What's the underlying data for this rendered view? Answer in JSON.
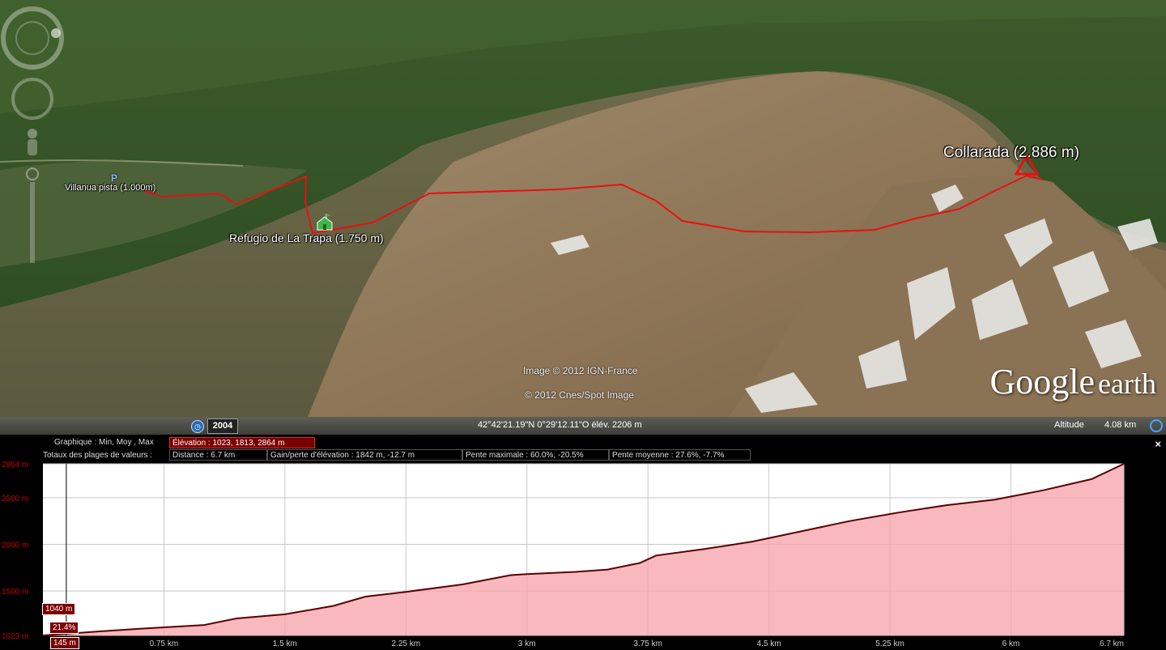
{
  "map": {
    "route_color": "#e81010",
    "labels": {
      "start": "Villanua pista (1.000m)",
      "refuge": "Refugio de La Trapa (1.750 m)",
      "summit": "Collarada (2.886 m)"
    },
    "icons": {
      "start": "parking-icon",
      "refuge": "hut-flag-icon",
      "summit": "summit-triangle-icon"
    },
    "credits": [
      "Image © 2012 IGN-France",
      "© 2012 Cnes/Spot Image"
    ],
    "logo": {
      "google": "Google",
      "earth": "earth"
    }
  },
  "statusbar": {
    "year": "2004",
    "coords": "42°42'21.19\"N   0°29'12.11\"O  élév. 2206 m",
    "altitude_label": "Altitude",
    "altitude_value": "4.08 km"
  },
  "profile": {
    "graph_label": "Graphique : Min, Moy , Max",
    "elevation": "Élévation : 1023, 1813, 2864 m",
    "totals_label": "Totaux des plages de valeurs :",
    "distance": "Distance : 6.7 km",
    "gain_loss": "Gain/perte d'élévation : 1842 m, -12.7 m",
    "max_slope": "Pente maximale : 60.0%, -20.5%",
    "avg_slope": "Pente moyenne : 27.6%, -7.7%",
    "close": "×",
    "cursor": {
      "elevation": "1040 m",
      "slope": "21.4%",
      "distance": "145 m",
      "distance_km": 0.145
    }
  },
  "chart_data": {
    "type": "area",
    "xlabel": "",
    "ylabel": "",
    "xlim": [
      0,
      6.7
    ],
    "ylim": [
      1023,
      2864
    ],
    "y_ticks": [
      1023,
      1500,
      2000,
      2500,
      2864
    ],
    "y_tick_labels": [
      "1023 m",
      "1500 m",
      "2000 m",
      "2500 m",
      "2864 m"
    ],
    "x_ticks": [
      0.75,
      1.5,
      2.25,
      3,
      3.75,
      4.5,
      5.25,
      6,
      6.7
    ],
    "x_tick_labels": [
      "0.75 km",
      "1.5 km",
      "2.25 km",
      "3 km",
      "3.75 km",
      "4.5 km",
      "5.25 km",
      "6 km",
      "6.7 km"
    ],
    "line_color": "#5a0000",
    "fill_color": "#f5a0a8",
    "series": [
      {
        "x": [
          0,
          0.3,
          0.6,
          1.0,
          1.2,
          1.5,
          1.8,
          2.0,
          2.25,
          2.6,
          2.9,
          3.0,
          3.3,
          3.5,
          3.7,
          3.8,
          4.1,
          4.4,
          4.7,
          5.0,
          5.3,
          5.6,
          5.9,
          6.2,
          6.5,
          6.7
        ],
        "y": [
          1023,
          1060,
          1095,
          1135,
          1205,
          1250,
          1340,
          1440,
          1490,
          1570,
          1670,
          1680,
          1705,
          1730,
          1800,
          1880,
          1950,
          2030,
          2140,
          2250,
          2340,
          2420,
          2480,
          2580,
          2700,
          2864
        ]
      }
    ]
  }
}
